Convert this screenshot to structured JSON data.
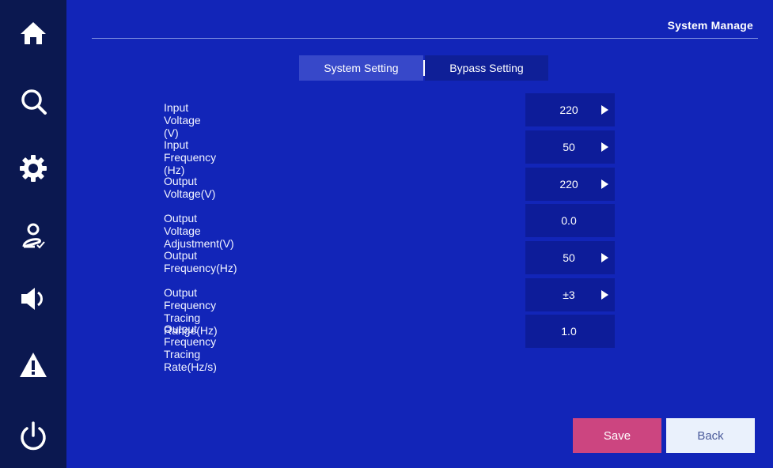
{
  "page_title": "System Manage",
  "sidebar": {
    "items": [
      {
        "icon": "home-icon"
      },
      {
        "icon": "search-icon"
      },
      {
        "icon": "gear-icon"
      },
      {
        "icon": "user-check-icon"
      },
      {
        "icon": "speaker-icon"
      },
      {
        "icon": "warning-icon"
      },
      {
        "icon": "power-icon"
      }
    ]
  },
  "tabs": [
    {
      "label": "System Setting",
      "active": true
    },
    {
      "label": "Bypass Setting",
      "active": false
    }
  ],
  "settings": [
    {
      "label": "Input Voltage (V)",
      "value": "220",
      "has_arrow": true
    },
    {
      "label": "Input Frequency (Hz)",
      "value": "50",
      "has_arrow": true
    },
    {
      "label": "Output Voltage(V)",
      "value": "220",
      "has_arrow": true
    },
    {
      "label": "Output Voltage Adjustment(V)",
      "value": "0.0",
      "has_arrow": false
    },
    {
      "label": "Output Frequency(Hz)",
      "value": "50",
      "has_arrow": true
    },
    {
      "label": "Output Frequency Tracing Range(Hz)",
      "value": "±3",
      "has_arrow": true
    },
    {
      "label": "Output Frequency Tracing Rate(Hz/s)",
      "value": "1.0",
      "has_arrow": false
    }
  ],
  "buttons": {
    "save_label": "Save",
    "back_label": "Back"
  },
  "colors": {
    "background": "#1225b8",
    "sidebar": "#0b1850",
    "save_button": "#cc4580",
    "back_button": "#eaf1fc",
    "value_box": "#0d1c99"
  }
}
